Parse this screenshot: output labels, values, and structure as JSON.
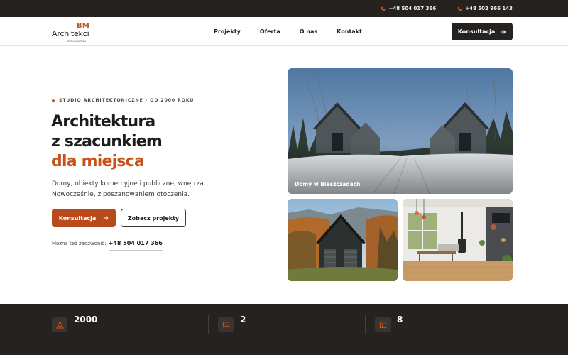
{
  "topbar": {
    "phones": [
      "+48 504 017 366",
      "+48 502 966 143"
    ]
  },
  "logo": {
    "bm": "BM",
    "name": "Architekci",
    "tagline": "Studio projektowe"
  },
  "nav": {
    "items": [
      "Projekty",
      "Oferta",
      "O nas",
      "Kontakt"
    ]
  },
  "header": {
    "cta": "Konsultacja"
  },
  "hero": {
    "eyebrow": "STUDIO ARCHITEKTONICZNE · OD 2000 ROKU",
    "title_line1": "Architektura",
    "title_line2": "z szacunkiem",
    "title_accent": "dla miejsca",
    "lead_line1": "Domy, obiekty komercyjne i publiczne, wnętrza.",
    "lead_line2": "Nowocześnie, z poszanowaniem otoczenia.",
    "primary_cta": "Konsultacja",
    "secondary_cta": "Zobacz projekty",
    "call_label": "Można też zadzwonić:",
    "call_number": "+48 504 017 366"
  },
  "gallery": {
    "main_caption": "Domy w Bieszczadach"
  },
  "stats": {
    "values": [
      "2000",
      "2",
      "8"
    ]
  },
  "colors": {
    "accent": "#c6541a",
    "dark": "#252220",
    "text": "#1e1b18"
  },
  "icons": [
    "phone-icon",
    "arrow-right-icon",
    "architecture-icon",
    "chat-icon",
    "layout-icon"
  ]
}
